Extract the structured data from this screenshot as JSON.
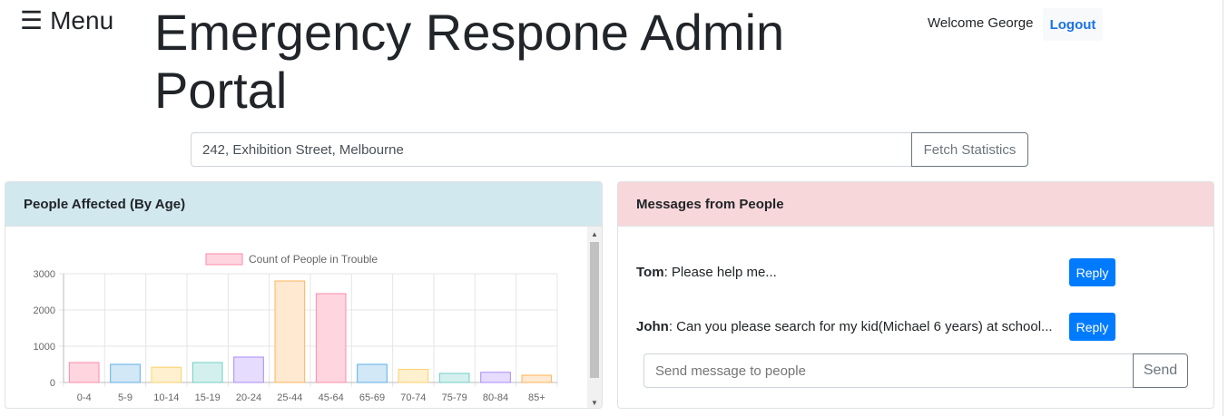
{
  "header": {
    "menu_icon": "☰",
    "menu_label": "Menu",
    "title": "Emergency Respone Admin Portal",
    "welcome": "Welcome George",
    "logout_label": "Logout"
  },
  "search": {
    "value": "242, Exhibition Street, Melbourne",
    "fetch_label": "Fetch Statistics"
  },
  "age_card": {
    "title": "People Affected (By Age)"
  },
  "chart_data": {
    "type": "bar",
    "categories": [
      "0-4",
      "5-9",
      "10-14",
      "15-19",
      "20-24",
      "25-44",
      "45-64",
      "65-69",
      "70-74",
      "75-79",
      "80-84",
      "85+"
    ],
    "series": [
      {
        "name": "Count of People in Trouble",
        "values": [
          550,
          500,
          420,
          550,
          700,
          2800,
          2450,
          500,
          360,
          250,
          280,
          200
        ]
      }
    ],
    "ylim": [
      0,
      3000
    ],
    "yticks": [
      0,
      1000,
      2000,
      3000
    ],
    "grid": true,
    "legend": "top",
    "colors": {
      "fills": [
        "#ffd6e0",
        "#d2e8f7",
        "#fff1cf",
        "#d4f0ee",
        "#e6dcfd",
        "#ffe9d1",
        "#ffd6e0",
        "#d2e8f7",
        "#fff1cf",
        "#d4f0ee",
        "#e6dcfd",
        "#ffe9d1"
      ],
      "strokes": [
        "#ff8aaa",
        "#5eaee6",
        "#ffd066",
        "#6fcfc4",
        "#a98bf9",
        "#ffb45a",
        "#ff8aaa",
        "#5eaee6",
        "#ffd066",
        "#6fcfc4",
        "#a98bf9",
        "#ffb45a"
      ]
    }
  },
  "messages_card": {
    "title": "Messages from People",
    "messages": [
      {
        "sender": "Tom",
        "text": ": Please help me...",
        "reply_label": "Reply"
      },
      {
        "sender": "John",
        "text": ": Can you please search for my kid(Michael 6 years) at school...",
        "reply_label": "Reply"
      }
    ],
    "send_placeholder": "Send message to people",
    "send_label": "Send"
  }
}
